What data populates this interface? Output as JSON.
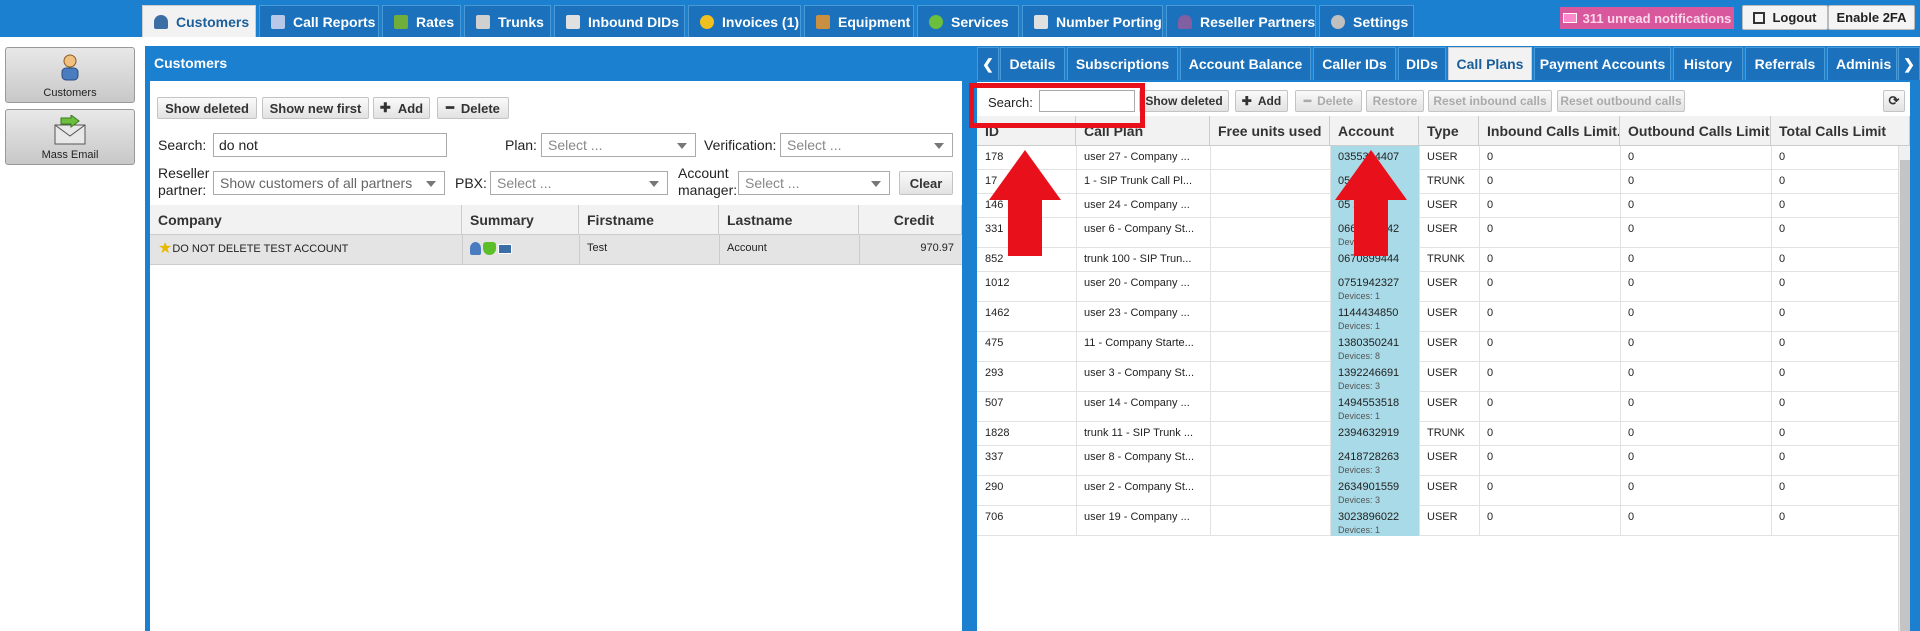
{
  "nav": {
    "tabs": [
      {
        "label": "Customers",
        "icon": "person-icon",
        "color": "#3a6ea5"
      },
      {
        "label": "Call Reports",
        "icon": "report-icon",
        "color": "#b8c8e8"
      },
      {
        "label": "Rates",
        "icon": "rates-icon",
        "color": "#6fae3a"
      },
      {
        "label": "Trunks",
        "icon": "trunk-icon",
        "color": "#d0d0d0"
      },
      {
        "label": "Inbound DIDs",
        "icon": "list-icon",
        "color": "#e0e0e0"
      },
      {
        "label": "Invoices (1)",
        "icon": "coins-icon",
        "color": "#f0c020"
      },
      {
        "label": "Equipment",
        "icon": "box-icon",
        "color": "#c89040"
      },
      {
        "label": "Services",
        "icon": "services-icon",
        "color": "#6cbf3c"
      },
      {
        "label": "Number Porting",
        "icon": "phone-icon",
        "color": "#e0e0e0"
      },
      {
        "label": "Reseller Partners",
        "icon": "partner-icon",
        "color": "#8060a0"
      },
      {
        "label": "Settings",
        "icon": "gear-icon",
        "color": "#c0c0c0"
      }
    ],
    "notifications": "311 unread notifications",
    "logout": "Logout",
    "enable2fa": "Enable 2FA"
  },
  "sidebar": {
    "customers": "Customers",
    "mass_email": "Mass Email"
  },
  "customers": {
    "title": "Customers",
    "show_deleted": "Show deleted",
    "show_new_first": "Show new first",
    "add": "Add",
    "delete": "Delete",
    "search_label": "Search:",
    "search_value": "do not",
    "plan_label": "Plan:",
    "plan_placeholder": "Select ...",
    "verification_label": "Verification:",
    "verification_placeholder": "Select ...",
    "reseller_label_1": "Reseller",
    "reseller_label_2": "partner:",
    "reseller_value": "Show customers of all partners",
    "pbx_label": "PBX:",
    "pbx_placeholder": "Select ...",
    "manager_label_1": "Account",
    "manager_label_2": "manager:",
    "manager_placeholder": "Select ...",
    "clear": "Clear",
    "columns": [
      "Company",
      "Summary",
      "Firstname",
      "Lastname",
      "Credit"
    ],
    "rows": [
      {
        "company": "DO NOT DELETE TEST ACCOUNT",
        "firstname": "Test",
        "lastname": "Account",
        "credit": "970.97"
      }
    ]
  },
  "details": {
    "tabs": [
      "Details",
      "Subscriptions",
      "Account Balance",
      "Caller IDs",
      "DIDs",
      "Call Plans",
      "Payment Accounts",
      "History",
      "Referrals",
      "Adminis"
    ],
    "active_tab": "Call Plans",
    "search_label": "Search:",
    "search_value": "",
    "show_deleted": "Show deleted",
    "add": "Add",
    "delete": "Delete",
    "restore": "Restore",
    "reset_inbound": "Reset inbound calls",
    "reset_outbound": "Reset outbound calls",
    "columns": [
      "ID",
      "Call Plan",
      "Free units used",
      "Account",
      "Type",
      "Inbound Calls Limit...",
      "Outbound Calls Limit...",
      "Total Calls Limit"
    ],
    "rows": [
      {
        "id": "178",
        "plan": "user 27 - Company ...",
        "account": "0355344407",
        "devices": "",
        "type": "USER",
        "inbound": "0",
        "outbound": "0",
        "total": "0"
      },
      {
        "id": "17",
        "plan": "1 - SIP Trunk Call Pl...",
        "account": "0511 45",
        "devices": "",
        "type": "TRUNK",
        "inbound": "0",
        "outbound": "0",
        "total": "0"
      },
      {
        "id": "146",
        "plan": "user 24 - Company ...",
        "account": "05 2779",
        "devices": "",
        "type": "USER",
        "inbound": "0",
        "outbound": "0",
        "total": "0"
      },
      {
        "id": "331",
        "plan": "user 6 - Company St...",
        "account": "0663629242",
        "devices": "Devices: 3",
        "type": "USER",
        "inbound": "0",
        "outbound": "0",
        "total": "0"
      },
      {
        "id": "852",
        "plan": "trunk 100 - SIP Trun...",
        "account": "0670899444",
        "devices": "",
        "type": "TRUNK",
        "inbound": "0",
        "outbound": "0",
        "total": "0"
      },
      {
        "id": "1012",
        "plan": "user 20 - Company ...",
        "account": "0751942327",
        "devices": "Devices: 1",
        "type": "USER",
        "inbound": "0",
        "outbound": "0",
        "total": "0"
      },
      {
        "id": "1462",
        "plan": "user 23 - Company ...",
        "account": "1144434850",
        "devices": "Devices: 1",
        "type": "USER",
        "inbound": "0",
        "outbound": "0",
        "total": "0"
      },
      {
        "id": "475",
        "plan": "11 - Company Starte...",
        "account": "1380350241",
        "devices": "Devices: 8",
        "type": "USER",
        "inbound": "0",
        "outbound": "0",
        "total": "0"
      },
      {
        "id": "293",
        "plan": "user 3 - Company St...",
        "account": "1392246691",
        "devices": "Devices: 3",
        "type": "USER",
        "inbound": "0",
        "outbound": "0",
        "total": "0"
      },
      {
        "id": "507",
        "plan": "user 14 - Company ...",
        "account": "1494553518",
        "devices": "Devices: 1",
        "type": "USER",
        "inbound": "0",
        "outbound": "0",
        "total": "0"
      },
      {
        "id": "1828",
        "plan": "trunk 11 - SIP Trunk ...",
        "account": "2394632919",
        "devices": "",
        "type": "TRUNK",
        "inbound": "0",
        "outbound": "0",
        "total": "0"
      },
      {
        "id": "337",
        "plan": "user 8 - Company St...",
        "account": "2418728263",
        "devices": "Devices: 3",
        "type": "USER",
        "inbound": "0",
        "outbound": "0",
        "total": "0"
      },
      {
        "id": "290",
        "plan": "user 2 - Company St...",
        "account": "2634901559",
        "devices": "Devices: 3",
        "type": "USER",
        "inbound": "0",
        "outbound": "0",
        "total": "0"
      },
      {
        "id": "706",
        "plan": "user 19 - Company ...",
        "account": "3023896022",
        "devices": "Devices: 1",
        "type": "USER",
        "inbound": "0",
        "outbound": "0",
        "total": "0"
      }
    ]
  },
  "colors": {
    "nav_blue": "#1b80cf",
    "annotation_red": "#e8111b",
    "account_cell": "#a9dae7",
    "notification_pink": "#d9589d"
  }
}
